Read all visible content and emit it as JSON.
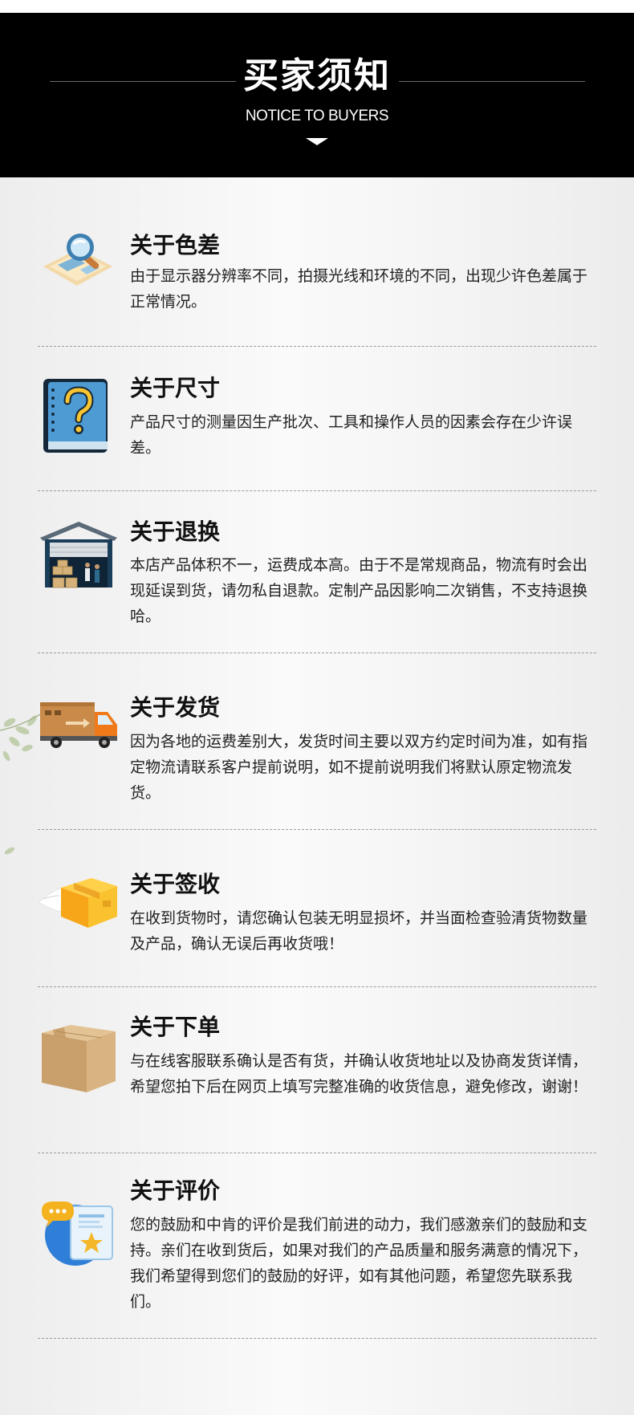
{
  "header": {
    "title": "买家须知",
    "subtitle": "NOTICE TO BUYERS"
  },
  "sections": [
    {
      "title": "关于色差",
      "text": "由于显示器分辨率不同，拍摄光线和环境的不同，出现少许色差属于正常情况。",
      "icon": "magnifier-map-icon"
    },
    {
      "title": "关于尺寸",
      "text": "产品尺寸的测量因生产批次、工具和操作人员的因素会存在少许误差。",
      "icon": "question-book-icon"
    },
    {
      "title": "关于退换",
      "text": "本店产品体积不一，运费成本高。由于不是常规商品，物流有时会出现延误到货，请勿私自退款。定制产品因影响二次销售，不支持退换哈。",
      "icon": "warehouse-icon"
    },
    {
      "title": "关于发货",
      "text": "因为各地的运费差别大，发货时间主要以双方约定时间为准，如有指定物流请联系客户提前说明，如不提前说明我们将默认原定物流发货。",
      "icon": "delivery-truck-icon"
    },
    {
      "title": "关于签收",
      "text": "在收到货物时，请您确认包装无明显损坏，并当面检查验清货物数量及产品，确认无误后再收货哦！",
      "icon": "flying-package-icon"
    },
    {
      "title": "关于下单",
      "text": "与在线客服联系确认是否有货，并确认收货地址以及协商发货详情，希望您拍下后在网页上填写完整准确的收货信息，避免修改，谢谢！",
      "icon": "cardboard-box-icon"
    },
    {
      "title": "关于评价",
      "text": "您的鼓励和中肯的评价是我们前进的动力，我们感激亲们的鼓励和支持。亲们在收到货后，如果对我们的产品质量和服务满意的情况下，我们希望得到您们的鼓励的好评，如有其他问题，希望您先联系我们。",
      "icon": "review-chat-icon"
    }
  ]
}
